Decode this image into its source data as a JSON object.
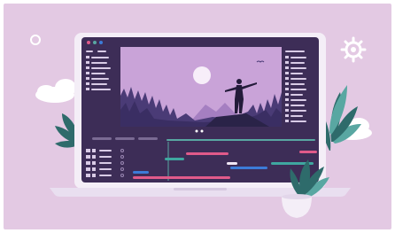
{
  "illustration": {
    "subject": "video-editing-laptop",
    "colors": {
      "background": "#e3c9e3",
      "laptop_frame": "#f4eef7",
      "editor_bg": "#3d2d57",
      "panel_bg": "#4a3868",
      "sky": "#c9a3d8",
      "mountain": "#a57fc1",
      "forest": "#4a3b76",
      "ground": "#2a2348",
      "person": "#231b3a",
      "cloud": "#ffffff",
      "leaf": "#2e6b6b",
      "leaf_light": "#59a7a2",
      "timeline_pink": "#e05a8a",
      "timeline_blue": "#3c7bd8",
      "timeline_teal": "#3fa7a0",
      "timeline_light": "#f0e6f5"
    }
  }
}
